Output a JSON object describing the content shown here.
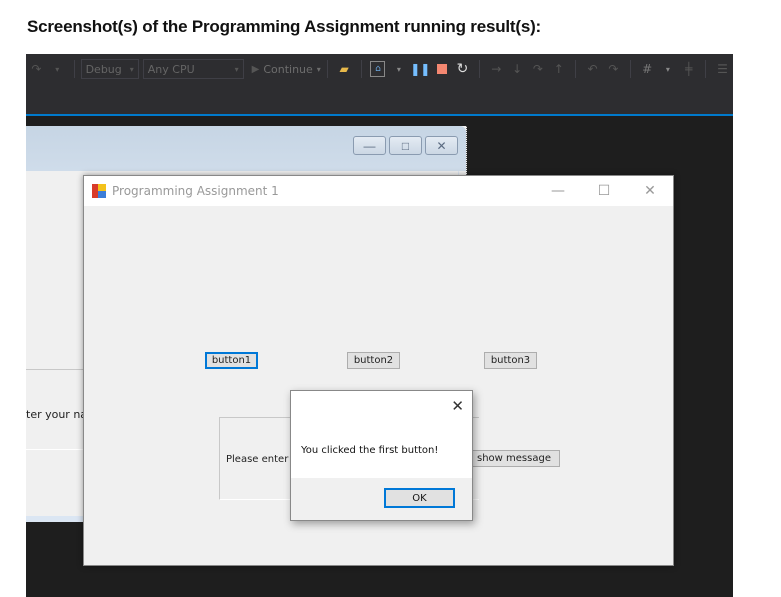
{
  "heading": "Screenshot(s) of the Programming Assignment running result(s):",
  "ide": {
    "toolbar": {
      "redo_icon": "redo-icon",
      "configuration": "Debug",
      "platform": "Any CPU",
      "continue_label": "Continue",
      "icons": [
        "find-in-files-icon",
        "xaml-icon",
        "pause-icon",
        "stop-icon",
        "restart-icon",
        "step-over-icon",
        "step-into-icon",
        "step-out-icon",
        "undo-icon",
        "redo-icon",
        "breakpoint-icon",
        "align-icon"
      ]
    },
    "accent_color": "#007acc"
  },
  "background_window": {
    "label_fragment": "ter your nai",
    "buttons": {
      "minimize": "—",
      "maximize": "□",
      "close": "✕"
    }
  },
  "form": {
    "title": "Programming Assignment 1",
    "controls": {
      "minimize": "—",
      "maximize": "☐",
      "close": "✕"
    },
    "buttons": [
      {
        "label": "button1",
        "focused": true
      },
      {
        "label": "button2",
        "focused": false
      },
      {
        "label": "button3",
        "focused": false
      }
    ],
    "groupbox_label": "Please enter yo",
    "show_message_button": "show message"
  },
  "message_box": {
    "close": "✕",
    "text": "You clicked the first button!",
    "ok_label": "OK"
  }
}
